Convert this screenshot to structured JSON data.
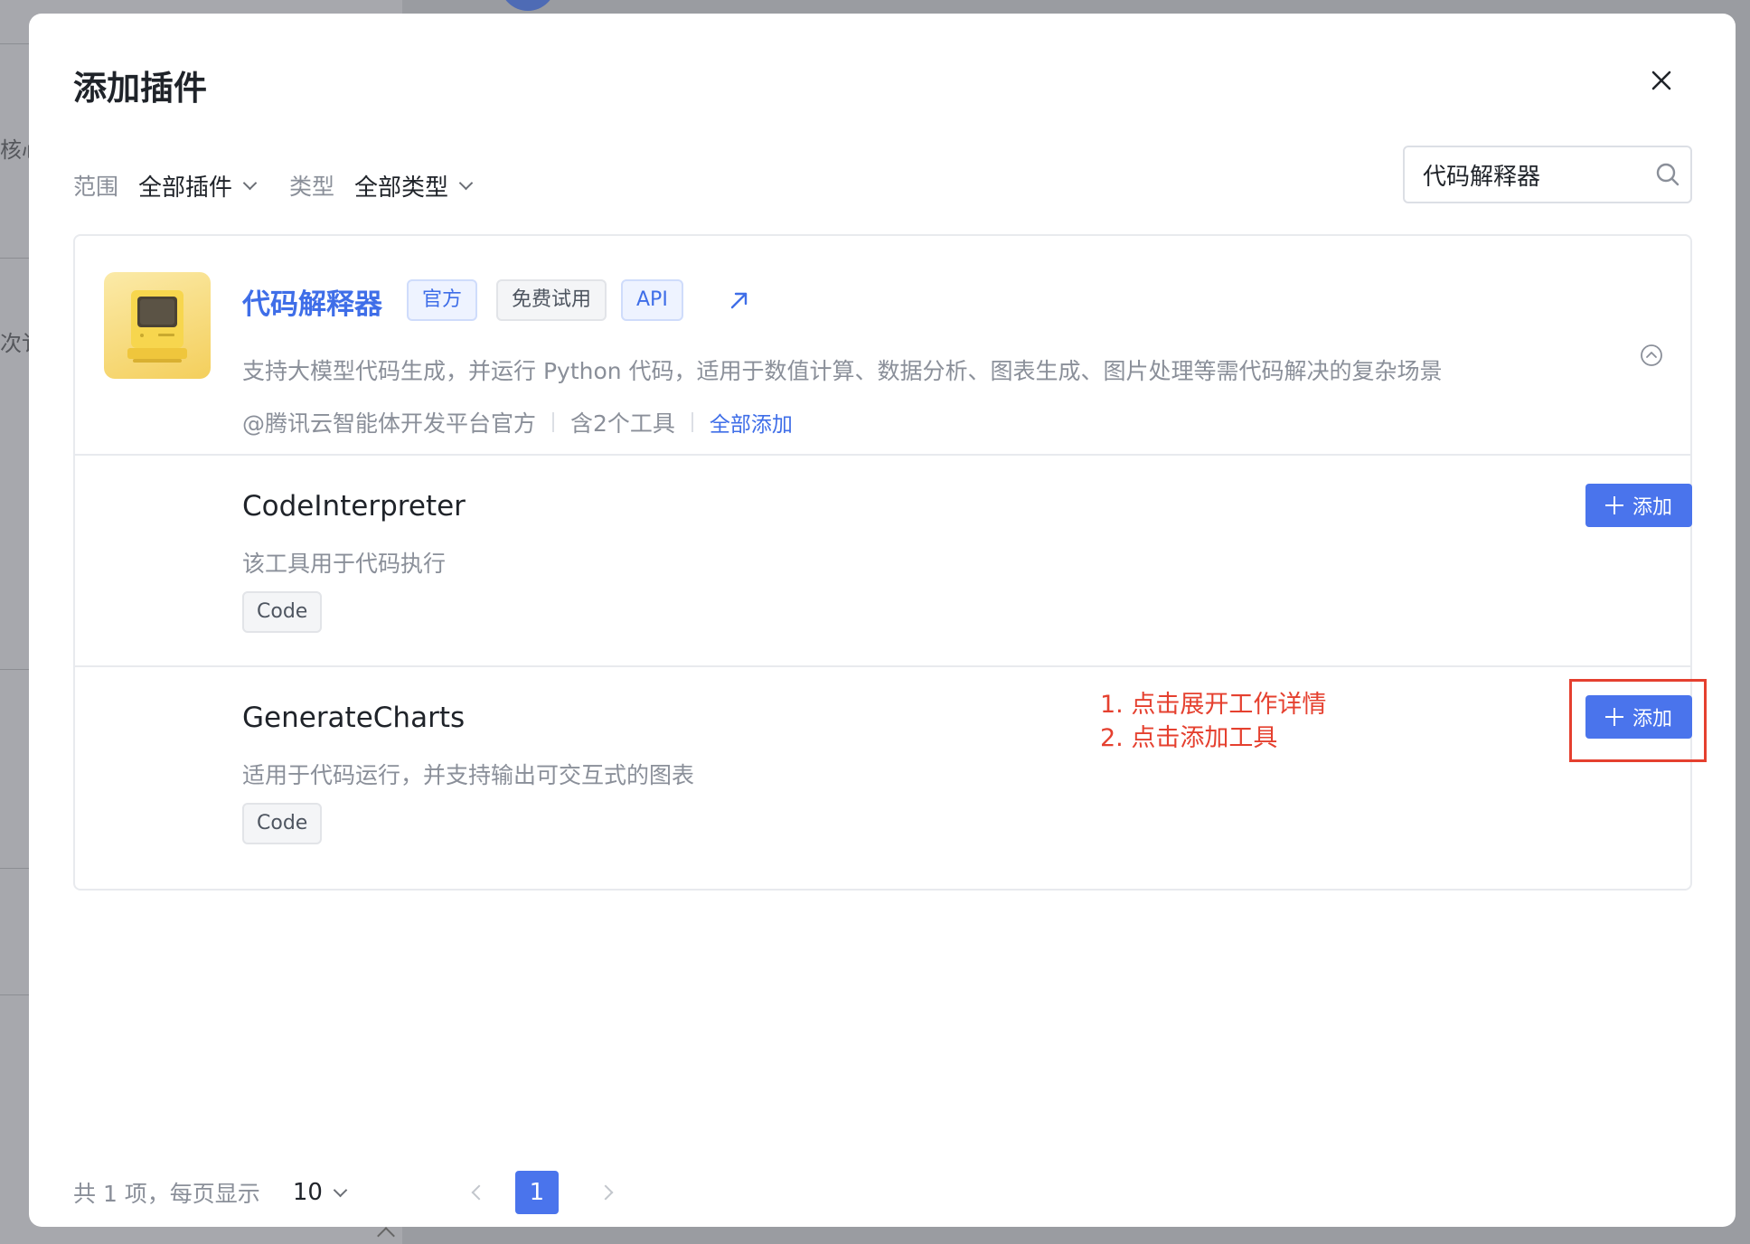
{
  "background": {
    "fragments": [
      "核心",
      "次讠"
    ]
  },
  "modal": {
    "title": "添加插件"
  },
  "filters": {
    "scope_label": "范围",
    "scope_value": "全部插件",
    "type_label": "类型",
    "type_value": "全部类型"
  },
  "search": {
    "value": "代码解释器"
  },
  "plugin": {
    "name": "代码解释器",
    "tags": [
      "官方",
      "免费试用",
      "API"
    ],
    "description": "支持大模型代码生成，并运行 Python 代码，适用于数值计算、数据分析、图表生成、图片处理等需代码解决的复杂场景",
    "author": "@腾讯云智能体开发平台官方",
    "tool_count": "含2个工具",
    "add_all_label": "全部添加"
  },
  "tools": [
    {
      "name": "CodeInterpreter",
      "description": "该工具用于代码执行",
      "tag": "Code",
      "add_label": "添加"
    },
    {
      "name": "GenerateCharts",
      "description": "适用于代码运行，并支持输出可交互式的图表",
      "tag": "Code",
      "add_label": "添加"
    }
  ],
  "annotation": {
    "line1": "1. 点击展开工作详情",
    "line2": "2. 点击添加工具"
  },
  "pagination": {
    "total_text": "共 1 项，每页显示",
    "page_size": "10",
    "current_page": "1"
  },
  "colors": {
    "accent": "#4a74ec",
    "annotation": "#e5402f"
  }
}
